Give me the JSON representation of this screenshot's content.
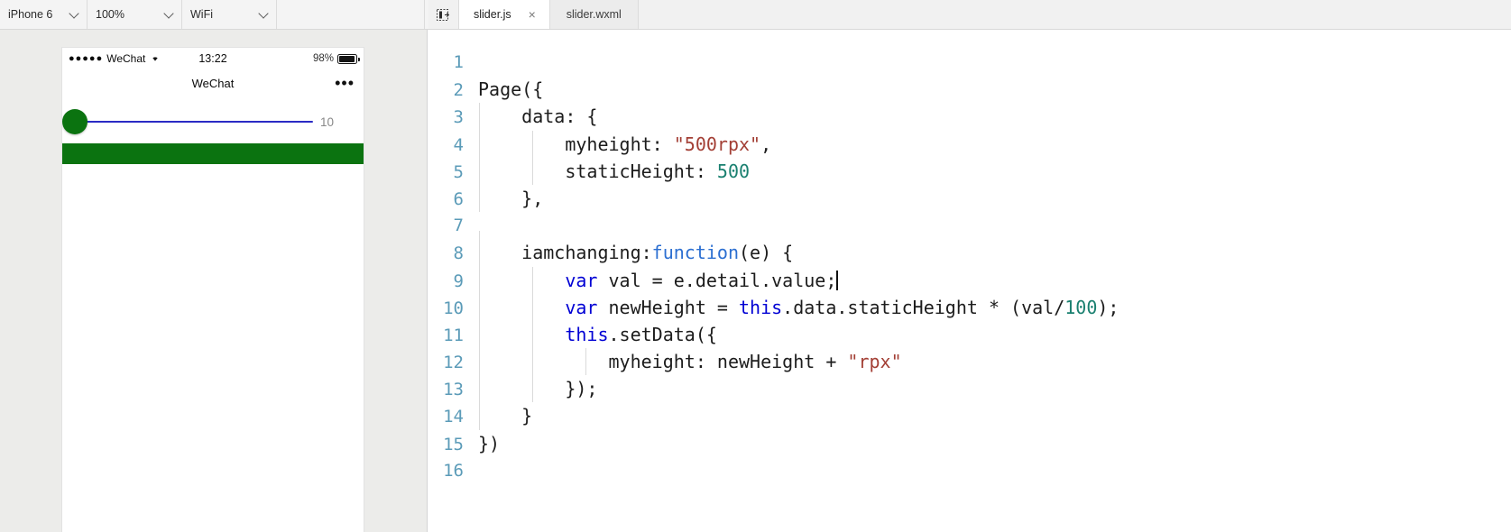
{
  "toolbar": {
    "device": "iPhone 6",
    "zoom": "100%",
    "network": "WiFi",
    "chevron_icon": "chevron-down-icon"
  },
  "tabs": {
    "panel_toggle_icon": "panel-collapse-right-icon",
    "items": [
      {
        "label": "slider.js",
        "active": true,
        "close_icon": "×"
      },
      {
        "label": "slider.wxml",
        "active": false
      }
    ]
  },
  "simulator": {
    "status_bar": {
      "signal_dots": "●●●●●",
      "carrier": "WeChat",
      "wifi_icon": "▾",
      "time": "13:22",
      "battery_percent": "98%",
      "battery_icon": "battery-icon"
    },
    "nav_bar": {
      "title": "WeChat",
      "more_icon": "•••"
    },
    "slider": {
      "value_label": "10",
      "thumb_color": "#0b7310",
      "track_color": "#2b2bc4",
      "value_color": "#888888"
    },
    "preview_block": {
      "color": "#0b7310"
    }
  },
  "editor": {
    "language": "javascript",
    "caret_line": 9,
    "lines": [
      {
        "n": "1",
        "tokens": []
      },
      {
        "n": "2",
        "tokens": [
          {
            "t": "Page({",
            "c": ""
          }
        ]
      },
      {
        "n": "3",
        "tokens": [
          {
            "t": "    data: {",
            "c": ""
          }
        ]
      },
      {
        "n": "4",
        "tokens": [
          {
            "t": "        myheight: ",
            "c": ""
          },
          {
            "t": "\"500rpx\"",
            "c": "str"
          },
          {
            "t": ",",
            "c": ""
          }
        ]
      },
      {
        "n": "5",
        "tokens": [
          {
            "t": "        staticHeight: ",
            "c": ""
          },
          {
            "t": "500",
            "c": "num"
          }
        ]
      },
      {
        "n": "6",
        "tokens": [
          {
            "t": "    },",
            "c": ""
          }
        ]
      },
      {
        "n": "7",
        "tokens": []
      },
      {
        "n": "8",
        "tokens": [
          {
            "t": "    iamchanging:",
            "c": ""
          },
          {
            "t": "function",
            "c": "fn"
          },
          {
            "t": "(e) {",
            "c": ""
          }
        ]
      },
      {
        "n": "9",
        "tokens": [
          {
            "t": "        ",
            "c": ""
          },
          {
            "t": "var",
            "c": "kw"
          },
          {
            "t": " val = e.detail.value;",
            "c": ""
          }
        ]
      },
      {
        "n": "10",
        "tokens": [
          {
            "t": "        ",
            "c": ""
          },
          {
            "t": "var",
            "c": "kw"
          },
          {
            "t": " newHeight = ",
            "c": ""
          },
          {
            "t": "this",
            "c": "kw"
          },
          {
            "t": ".data.staticHeight * (val/",
            "c": ""
          },
          {
            "t": "100",
            "c": "num"
          },
          {
            "t": ");",
            "c": ""
          }
        ]
      },
      {
        "n": "11",
        "tokens": [
          {
            "t": "        ",
            "c": ""
          },
          {
            "t": "this",
            "c": "kw"
          },
          {
            "t": ".setData({",
            "c": ""
          }
        ]
      },
      {
        "n": "12",
        "tokens": [
          {
            "t": "            myheight: newHeight + ",
            "c": ""
          },
          {
            "t": "\"rpx\"",
            "c": "str"
          }
        ]
      },
      {
        "n": "13",
        "tokens": [
          {
            "t": "        });",
            "c": ""
          }
        ]
      },
      {
        "n": "14",
        "tokens": [
          {
            "t": "    }",
            "c": ""
          }
        ]
      },
      {
        "n": "15",
        "tokens": [
          {
            "t": "})",
            "c": ""
          }
        ]
      },
      {
        "n": "16",
        "tokens": []
      }
    ]
  },
  "cursor": {
    "click_highlight_color": "#ffe400",
    "click_ring_color": "#f05a5a",
    "pointer_icon": "text-ibeam-cursor"
  }
}
